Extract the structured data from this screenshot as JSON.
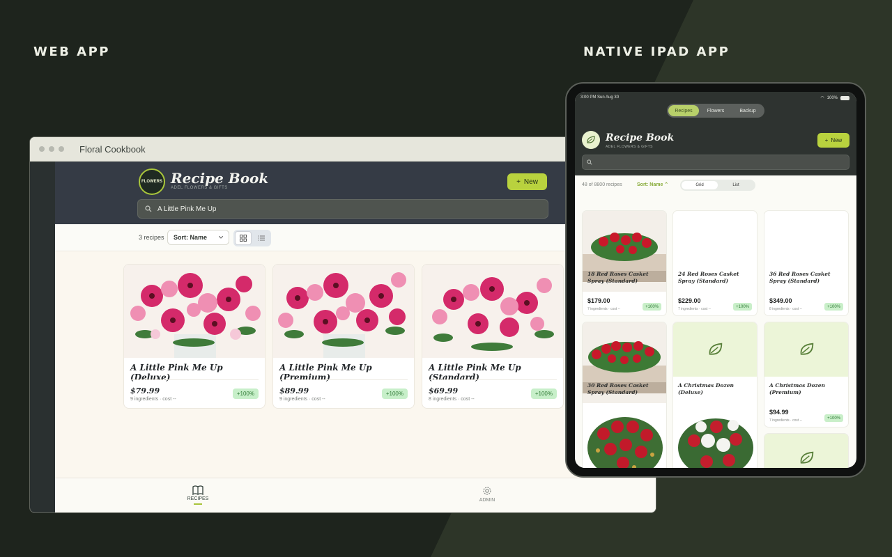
{
  "headings": {
    "web": "WEB APP",
    "ipad": "NATIVE IPAD APP"
  },
  "web": {
    "window_title": "Floral Cookbook",
    "logo_text": "FLOWERS",
    "app_title": "Recipe Book",
    "app_subtitle": "ADEL FLOWERS & GIFTS",
    "new_button": "New",
    "search_value": "A Little Pink Me Up",
    "recipe_count": "3 recipes",
    "sort_label": "Sort: Name",
    "cards": [
      {
        "title": "A Little Pink Me Up (Deluxe)",
        "price": "$79.99",
        "meta": "9 ingredients · cost --",
        "badge": "+100%"
      },
      {
        "title": "A Little Pink Me Up (Premium)",
        "price": "$89.99",
        "meta": "9 ingredients · cost --",
        "badge": "+100%"
      },
      {
        "title": "A Little Pink Me Up (Standard)",
        "price": "$69.99",
        "meta": "8 ingredients · cost --",
        "badge": "+100%"
      }
    ],
    "nav": {
      "recipes": "RECIPES",
      "admin": "ADMIN"
    }
  },
  "ipad": {
    "status_time": "3:00 PM   Sun Aug 30",
    "status_battery": "100%",
    "tabs": [
      "Recipes",
      "Flowers",
      "Backup"
    ],
    "app_title": "Recipe Book",
    "app_subtitle": "ADEL FLOWERS & GIFTS",
    "new_button": "New",
    "recipe_count": "48 of 8800 recipes",
    "sort_label": "Sort: Name",
    "view_options": [
      "Grid",
      "List"
    ],
    "cards": [
      {
        "title": "18 Red Roses Casket Spray (Standard)",
        "price": "$179.00",
        "meta": "7 ingredients · cost --",
        "badge": "+100%"
      },
      {
        "title": "24 Red Roses Casket Spray (Standard)",
        "price": "$229.00",
        "meta": "7 ingredients · cost --",
        "badge": "+100%"
      },
      {
        "title": "36 Red Roses Casket Spray (Standard)",
        "price": "$349.00",
        "meta": "8 ingredients · cost --",
        "badge": "+100%"
      },
      {
        "title": "30 Red Roses Casket Spray (Standard)"
      },
      {
        "title": "A Christmas Dozen (Deluxe)"
      },
      {
        "title": "A Christmas Dozen (Premium)",
        "price": "$94.99",
        "meta": "7 ingredients · cost --",
        "badge": "+100%"
      }
    ]
  },
  "colors": {
    "accent": "#b9d23e",
    "header": "#353b45",
    "background": "#1e241d"
  }
}
